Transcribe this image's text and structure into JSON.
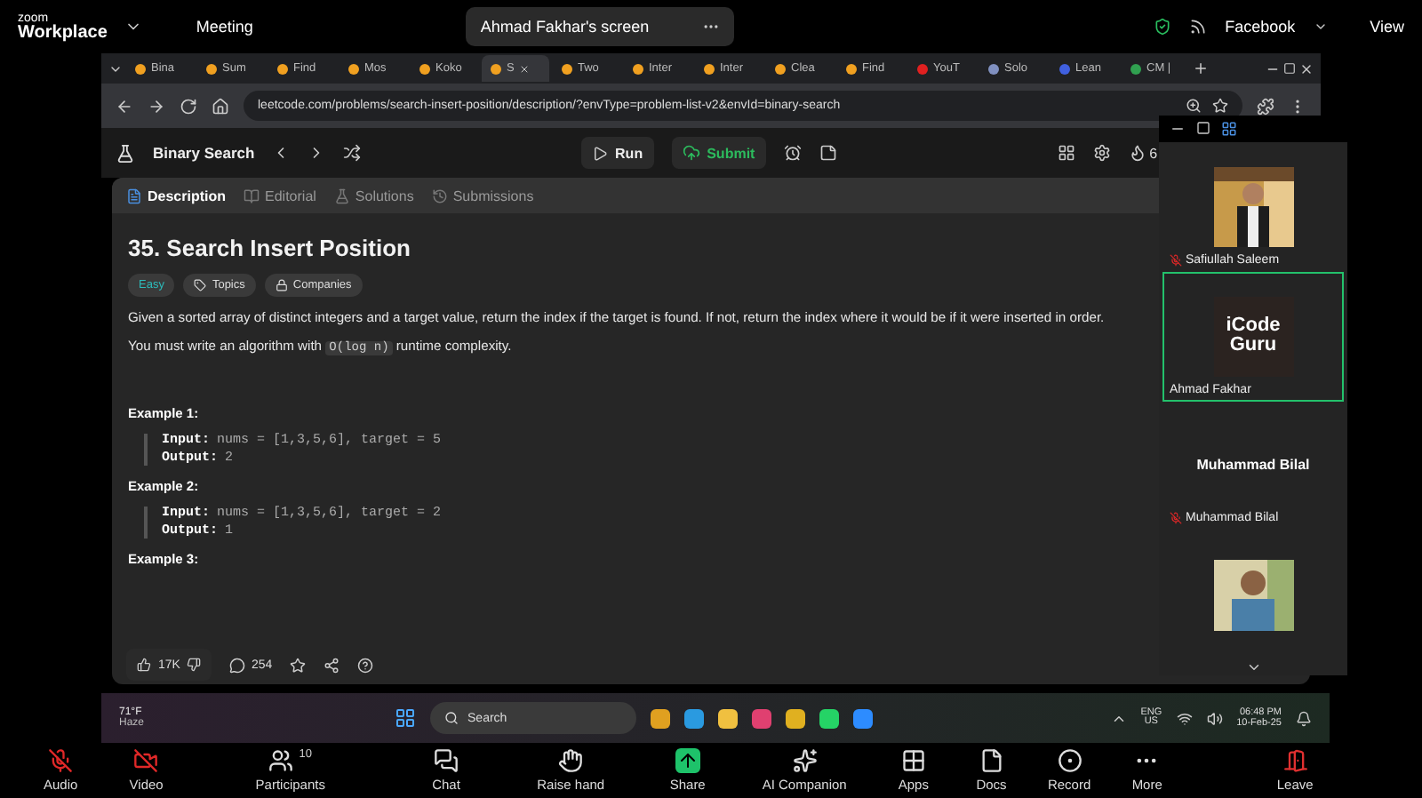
{
  "zoom_bar": {
    "brand_top": "zoom",
    "brand": "Workplace",
    "meeting": "Meeting",
    "share_label": "Ahmad Fakhar's screen",
    "account": "Facebook",
    "view": "View"
  },
  "browser": {
    "tabs": [
      {
        "label": "Bina",
        "color": "#f0a020",
        "selected": false
      },
      {
        "label": "Sum",
        "color": "#f0a020",
        "selected": false
      },
      {
        "label": "Find",
        "color": "#f0a020",
        "selected": false
      },
      {
        "label": "Mos",
        "color": "#f0a020",
        "selected": false
      },
      {
        "label": "Koko",
        "color": "#f0a020",
        "selected": false
      },
      {
        "label": "S",
        "color": "#f0a020",
        "selected": true
      },
      {
        "label": "Two",
        "color": "#f0a020",
        "selected": false
      },
      {
        "label": "Inter",
        "color": "#f0a020",
        "selected": false
      },
      {
        "label": "Inter",
        "color": "#f0a020",
        "selected": false
      },
      {
        "label": "Clea",
        "color": "#f0a020",
        "selected": false
      },
      {
        "label": "Find",
        "color": "#f0a020",
        "selected": false
      },
      {
        "label": "YouT",
        "color": "#e02020",
        "selected": false
      },
      {
        "label": "Solo",
        "color": "#8090c0",
        "selected": false
      },
      {
        "label": "Lean",
        "color": "#4060e0",
        "selected": false
      },
      {
        "label": "CM |",
        "color": "#30a050",
        "selected": false
      }
    ],
    "address": "leetcode.com/problems/search-insert-position/description/?envType=problem-list-v2&envId=binary-search"
  },
  "leetcode": {
    "list_name": "Binary Search",
    "run": "Run",
    "submit": "Submit",
    "streak": "6",
    "tabs": [
      {
        "label": "Description",
        "selected": true
      },
      {
        "label": "Editorial",
        "selected": false
      },
      {
        "label": "Solutions",
        "selected": false
      },
      {
        "label": "Submissions",
        "selected": false
      }
    ],
    "title": "35. Search Insert Position",
    "difficulty": "Easy",
    "topics": "Topics",
    "companies": "Companies",
    "paragraphs": [
      "Given a sorted array of distinct integers and a target value, return the index if the target is found. If not, return the index where it would be if it were inserted in order."
    ],
    "complexity": {
      "before": "You must write an algorithm with",
      "code": "O(log n)",
      "after": "runtime complexity."
    },
    "examples": [
      {
        "title": "Example 1:",
        "input_label": "Input:",
        "input": "nums = [1,3,5,6], target = 5",
        "output_label": "Output:",
        "output": "2"
      },
      {
        "title": "Example 2:",
        "input_label": "Input:",
        "input": "nums = [1,3,5,6], target = 2",
        "output_label": "Output:",
        "output": "1"
      },
      {
        "title": "Example 3:"
      }
    ],
    "likes": "17K",
    "comments": "254"
  },
  "participants": [
    {
      "kind": "video",
      "name": "Safiullah Saleem",
      "muted": true,
      "speaking": false
    },
    {
      "kind": "logo",
      "logo_lines": [
        "iCode",
        "Guru"
      ],
      "name": "Ahmad Fakhar",
      "muted": false,
      "speaking": true
    },
    {
      "kind": "name",
      "big_name": "Muhammad Bilal",
      "name": "Muhammad Bilal",
      "muted": true,
      "speaking": false
    },
    {
      "kind": "video",
      "speaking": false
    }
  ],
  "taskbar": {
    "temp": "71°F",
    "weather": "Haze",
    "search": "Search",
    "lang": "ENG",
    "region": "US",
    "time": "06:48 PM",
    "date": "10-Feb-25"
  },
  "toolbar": [
    {
      "kind": "audio",
      "label": "Audio",
      "off": true
    },
    {
      "kind": "video",
      "label": "Video",
      "off": true
    },
    {
      "kind": "participants",
      "label": "Participants",
      "count": "10"
    },
    {
      "kind": "chat",
      "label": "Chat"
    },
    {
      "kind": "hand",
      "label": "Raise hand"
    },
    {
      "kind": "share",
      "label": "Share"
    },
    {
      "kind": "ai",
      "label": "AI Companion"
    },
    {
      "kind": "apps",
      "label": "Apps"
    },
    {
      "kind": "docs",
      "label": "Docs"
    },
    {
      "kind": "record",
      "label": "Record"
    },
    {
      "kind": "more",
      "label": "More"
    },
    {
      "kind": "leave",
      "label": "Leave"
    }
  ]
}
